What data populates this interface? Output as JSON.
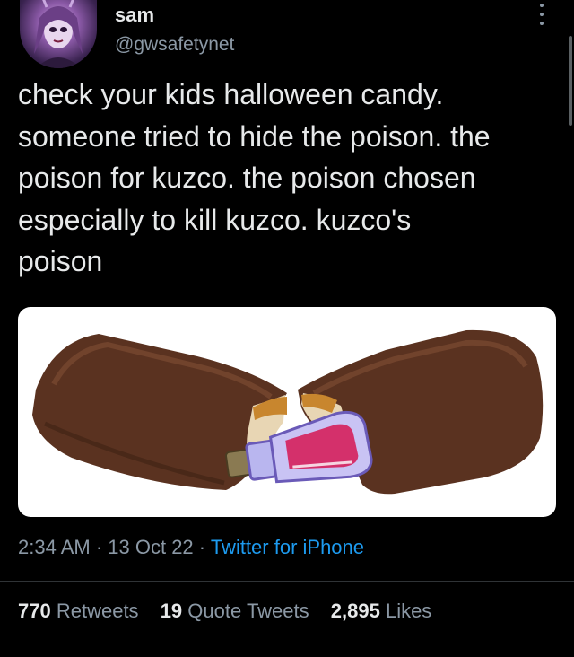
{
  "author": {
    "display_name": "sam",
    "handle": "@gwsafetynet"
  },
  "tweet": {
    "text": "check your kids halloween candy.\nsomeone tried to hide the poison. the\npoison for kuzco. the poison chosen\nespecially to kill kuzco. kuzco's\npoison",
    "media_icon": "candy-bar-with-poison-vial"
  },
  "meta": {
    "time": "2:34 AM",
    "sep1": " · ",
    "date": "13 Oct 22",
    "sep2": " · ",
    "source": "Twitter for iPhone"
  },
  "stats": {
    "retweets_count": "770",
    "retweets_label": "Retweets",
    "quotes_count": "19",
    "quotes_label": "Quote Tweets",
    "likes_count": "2,895",
    "likes_label": "Likes"
  },
  "colors": {
    "background": "#000000",
    "text": "#e7e9ea",
    "secondary": "#8b98a5",
    "link": "#1d9bf0",
    "divider": "#2f3336"
  }
}
